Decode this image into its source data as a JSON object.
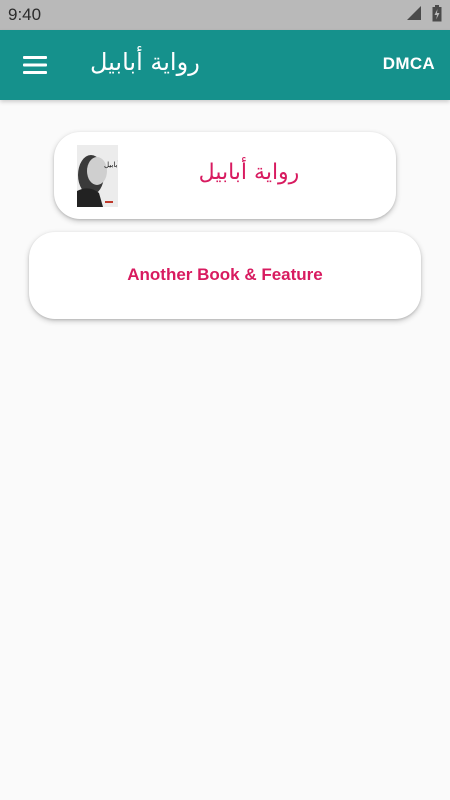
{
  "status_bar": {
    "time": "9:40",
    "icons": [
      "signal-icon",
      "battery-icon"
    ]
  },
  "app_bar": {
    "menu_icon": "hamburger-menu-icon",
    "title": "رواية أبابيل",
    "action_label": "DMCA",
    "color": "#15918c"
  },
  "cards": {
    "book": {
      "title": "رواية أبابيل",
      "cover_icon": "book-cover-image"
    },
    "feature": {
      "label": "Another Book & Feature"
    },
    "accent_color": "#d81b60"
  }
}
